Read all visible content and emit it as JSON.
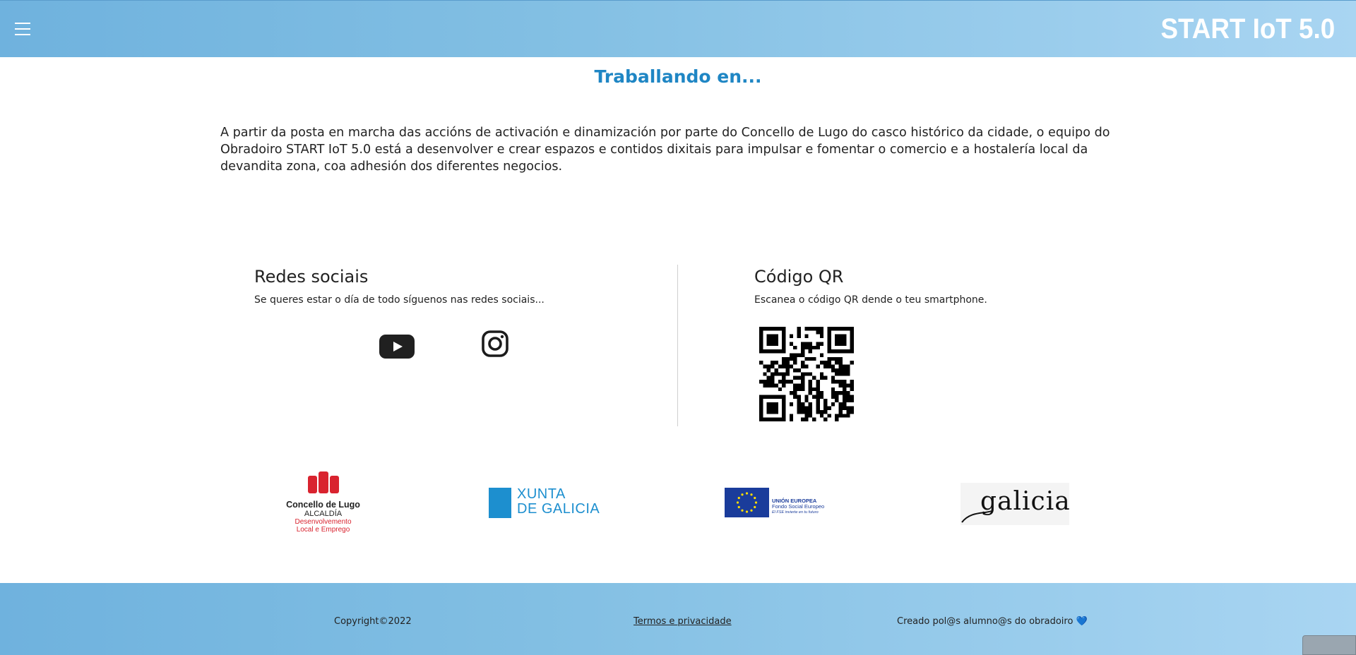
{
  "header": {
    "brand": "START IoT 5.0"
  },
  "main": {
    "title": "Traballando en...",
    "intro": "A partir da posta en marcha das accións de activación e dinamización por parte do Concello de Lugo do casco histórico da cidade, o equipo do Obradoiro START IoT 5.0 está a desenvolver e crear espazos e contidos dixitais para impulsar e fomentar o comercio e a hostalería local da devandita zona, coa adhesión dos diferentes negocios."
  },
  "social": {
    "title": "Redes sociais",
    "subtitle": "Se queres estar o día de todo síguenos nas redes sociais...",
    "icons": [
      "youtube-icon",
      "instagram-icon"
    ]
  },
  "qr": {
    "title": "Código QR",
    "subtitle": "Escanea o código QR dende o teu smartphone."
  },
  "logos": {
    "lugo": {
      "name": "Concello de Lugo",
      "line2": "ALCALDÍA",
      "line3": "Desenvolvemento",
      "line4": "Local e Emprego"
    },
    "xunta": {
      "line1": "XUNTA",
      "line2": "DE GALICIA"
    },
    "eu": {
      "line1": "UNIÓN EUROPEA",
      "line2": "Fondo Social Europeo",
      "line3": "El FSE invierte en tu futuro"
    },
    "galicia": {
      "word": "galicia"
    }
  },
  "footer": {
    "copyright": "Copyright©2022",
    "terms": "Termos e privacidade",
    "credit": "Creado pol@s alumno@s do obradoiro",
    "heart": "💙"
  },
  "colors": {
    "accent": "#1f86c4",
    "header_start": "#6fb2de",
    "header_end": "#a9d5f2",
    "lugo_red": "#d9232f",
    "xunta_blue": "#1d8fcf",
    "eu_blue": "#1a3c9b"
  }
}
